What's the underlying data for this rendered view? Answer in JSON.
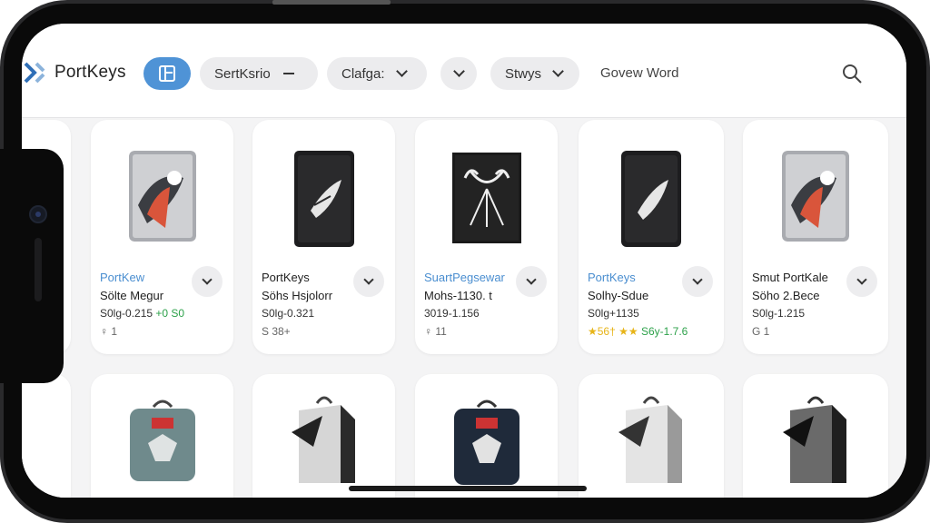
{
  "app": {
    "brand": "PortKeys"
  },
  "filters": {
    "pill1": "SertKsrio",
    "pill2": "Clafga:",
    "pill4": "Stwys",
    "link": "Govew Word"
  },
  "row1": [
    {
      "brand": "PortKew",
      "title": "Sölte Megur",
      "price": "S0lg-0.215",
      "price_extra": "+0 S0",
      "meta": "♀ 1"
    },
    {
      "brand": "PortKeys",
      "title": "Söhs Hsjolorr",
      "price": "S0lg-0.321",
      "price_extra": "",
      "meta": "S 38+"
    },
    {
      "brand": "SuartPegsewar",
      "title": "Mohs-1130. t",
      "price": "3019-1.156",
      "price_extra": "",
      "meta": "♀ 11"
    },
    {
      "brand": "PortKeys",
      "title": "Solhy-Sdue",
      "price": "S0lg+1135",
      "price_extra": "",
      "meta_stars": "★56† ★★",
      "meta_rest": "S6y-1.7.6"
    },
    {
      "brand": "Smut PortKale",
      "title": "Söho 2.Bece",
      "price": "S0lg-1.215",
      "price_extra": "",
      "meta": "G 1"
    }
  ],
  "colors": {
    "accent": "#4f93d6",
    "green": "#2da14a",
    "star": "#e7b418"
  }
}
